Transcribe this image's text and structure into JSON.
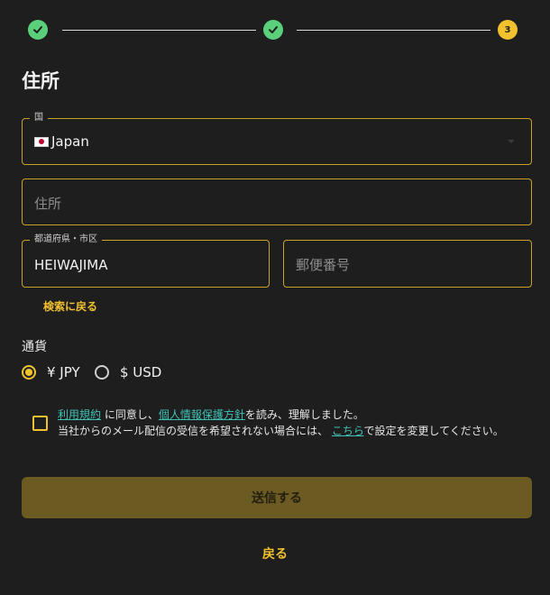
{
  "stepper": {
    "step3_label": "3"
  },
  "page_title": "住所",
  "country": {
    "label": "国",
    "value": "Japan"
  },
  "address": {
    "placeholder": "住所"
  },
  "prefecture": {
    "label": "都道府県・市区",
    "value": "HEIWAJIMA"
  },
  "postal": {
    "placeholder": "郵便番号"
  },
  "search_back": "検索に戻る",
  "currency": {
    "title": "通貨",
    "options": [
      {
        "label": "¥ JPY",
        "selected": true
      },
      {
        "label": "$ USD",
        "selected": false
      }
    ]
  },
  "terms": {
    "terms_link": "利用規約",
    "text1": " に同意し、",
    "privacy_link": "個人情報保護方針",
    "text2": "を読み、理解しました。",
    "text3": "当社からのメール配信の受信を希望されない場合には、 ",
    "here_link": "こちら",
    "text4": "で設定を変更してください。"
  },
  "submit_label": "送信する",
  "back_label": "戻る",
  "colors": {
    "accent": "#f2c12e",
    "success": "#5ad07a",
    "link": "#3fc1b5",
    "background": "#1e1e1e"
  }
}
